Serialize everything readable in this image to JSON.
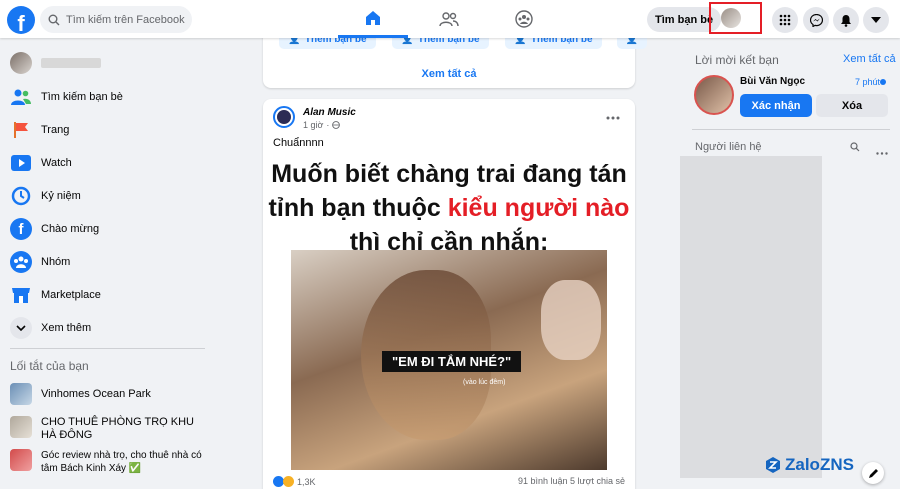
{
  "search": {
    "placeholder": "Tìm kiếm trên Facebook"
  },
  "header": {
    "logo": "f",
    "find_friends": "Tìm bạn bè"
  },
  "left_nav": {
    "profile_name": "",
    "items": [
      {
        "label": "Tìm kiếm bạn bè",
        "icon": "friends-icon"
      },
      {
        "label": "Trang",
        "icon": "flag-icon"
      },
      {
        "label": "Watch",
        "icon": "watch-icon"
      },
      {
        "label": "Kỷ niệm",
        "icon": "memories-icon"
      },
      {
        "label": "Chào mừng",
        "icon": "facebook-icon"
      },
      {
        "label": "Nhóm",
        "icon": "groups-icon"
      },
      {
        "label": "Marketplace",
        "icon": "marketplace-icon"
      },
      {
        "label": "Xem thêm",
        "icon": "chevron-down-icon"
      }
    ],
    "shortcuts_title": "Lối tắt của bạn",
    "shortcuts": [
      {
        "label": "Vinhomes Ocean Park"
      },
      {
        "label": "CHO THUÊ PHÒNG TRỌ KHU HÀ ĐÔNG"
      },
      {
        "label": "Góc review nhà trọ, cho thuê nhà có tâm Bách Kinh Xáy ✅"
      }
    ]
  },
  "suggestions": {
    "add_friend_label": "Thêm bạn bè",
    "see_all": "Xem tất cả"
  },
  "post": {
    "author": "Alan Music",
    "time": "1 giờ",
    "caption": "Chuẩnnnn",
    "image_text_line1": "Muốn biết chàng trai đang tán",
    "image_text_line2_a": "tỉnh bạn thuộc",
    "image_text_line2_b": "kiểu người nào",
    "image_text_line3": "thì chỉ cần nhắn:",
    "subtitle": "\"EM ĐI TẮM NHÉ?\"",
    "subtitle_small": "(vào lúc đêm)",
    "reactions": "1,3K",
    "stats": "91 bình luận  5 lượt chia sẻ"
  },
  "right": {
    "friend_requests_title": "Lời mời kết bạn",
    "see_all": "Xem tất cả",
    "requester_name": "Bùi Văn Ngọc",
    "request_time": "7 phút",
    "confirm": "Xác nhận",
    "delete": "Xóa",
    "contacts_title": "Người liên hệ"
  },
  "watermark": "ZaloZNS",
  "colors": {
    "accent": "#1877f2",
    "highlight": "#e41e26",
    "red_text": "#e41e26"
  }
}
